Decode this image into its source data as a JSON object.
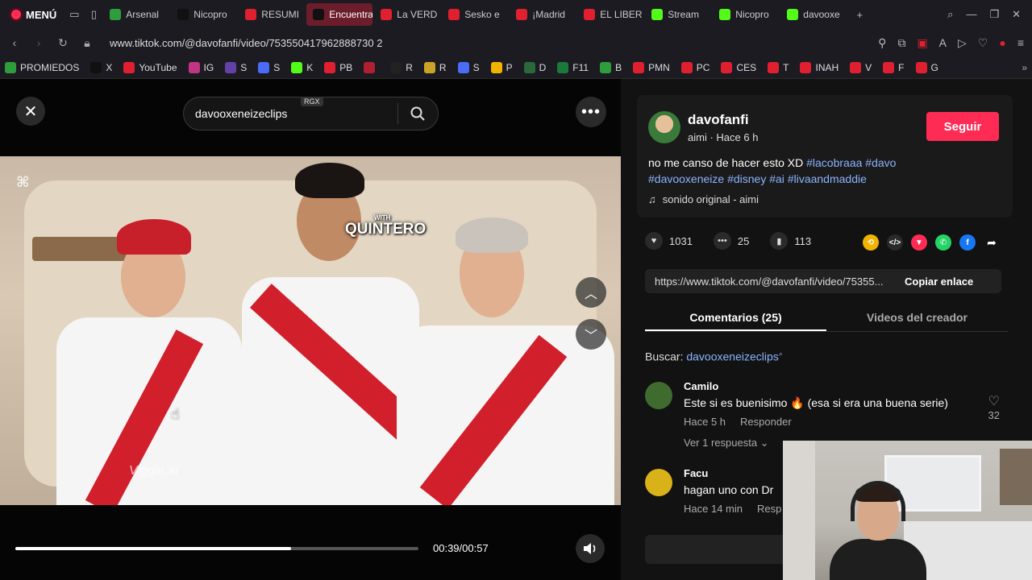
{
  "browser": {
    "menu_label": "MENÚ",
    "tabs": [
      {
        "label": "Arsenal",
        "color": "#2e9d3b"
      },
      {
        "label": "Nicopro",
        "color": "#111111"
      },
      {
        "label": "RESUMI",
        "color": "#e0202f"
      },
      {
        "label": "Encuentra",
        "color": "#111111",
        "active": true
      },
      {
        "label": "La VERD",
        "color": "#e0202f"
      },
      {
        "label": "Sesko e",
        "color": "#e0202f"
      },
      {
        "label": "¡Madrid",
        "color": "#e0202f"
      },
      {
        "label": "EL LIBER",
        "color": "#e0202f"
      },
      {
        "label": "Stream",
        "color": "#53fc18"
      },
      {
        "label": "Nicopro",
        "color": "#53fc18"
      },
      {
        "label": "davooxe",
        "color": "#53fc18"
      }
    ],
    "url": "www.tiktok.com/@davofanfi/video/753550417962888730 2",
    "bookmarks": [
      {
        "label": "PROMIEDOS",
        "color": "#2e9d3b"
      },
      {
        "label": "X",
        "color": "#111111"
      },
      {
        "label": "YouTube",
        "color": "#e0202f"
      },
      {
        "label": "IG",
        "color": "#c13584"
      },
      {
        "label": "S",
        "color": "#6441a5"
      },
      {
        "label": "S",
        "color": "#4a6cf7"
      },
      {
        "label": "K",
        "color": "#53fc18"
      },
      {
        "label": "PB",
        "color": "#e0202f"
      },
      {
        "label": "",
        "color": "#b02030"
      },
      {
        "label": "R",
        "color": "#222222"
      },
      {
        "label": "R",
        "color": "#c9a227"
      },
      {
        "label": "S",
        "color": "#4a6cf7"
      },
      {
        "label": "P",
        "color": "#f2b300"
      },
      {
        "label": "D",
        "color": "#2a6a3a"
      },
      {
        "label": "F11",
        "color": "#1a7a3a"
      },
      {
        "label": "B",
        "color": "#2e9d3b"
      },
      {
        "label": "PMN",
        "color": "#e0202f"
      },
      {
        "label": "PC",
        "color": "#e0202f"
      },
      {
        "label": "CES",
        "color": "#e0202f"
      },
      {
        "label": "T",
        "color": "#e0202f"
      },
      {
        "label": "INAH",
        "color": "#e0202f"
      },
      {
        "label": "V",
        "color": "#e0202f"
      },
      {
        "label": "F",
        "color": "#e0202f"
      },
      {
        "label": "G",
        "color": "#e0202f"
      }
    ]
  },
  "player": {
    "search_value": "davooxeneizeclips",
    "rgx_badge": "RGX",
    "overlay_small": "WITH",
    "overlay_big": "QUINTERO",
    "watermark": "Viggle.ai",
    "time": "00:39/00:57",
    "progress_fraction": 0.684
  },
  "post": {
    "author": "davofanfi",
    "meta": "aimi · Hace 6 h",
    "follow_label": "Seguir",
    "caption_text": "no me canso de hacer esto XD ",
    "hashtags_line1": [
      "#lacobraaa",
      "#davo"
    ],
    "hashtags_line2": [
      "#davooxeneize",
      "#disney",
      "#ai",
      "#livaandmaddie"
    ],
    "music": "sonido original - aimi",
    "likes": "1031",
    "comments": "25",
    "saves": "113",
    "link": "https://www.tiktok.com/@davofanfi/video/75355...",
    "copy_label": "Copiar enlace",
    "tab_comments": "Comentarios (25)",
    "tab_creator": "Videos del creador",
    "search_prefix": "Buscar:",
    "search_term": "davooxeneizeclips"
  },
  "comments": [
    {
      "name": "Camilo",
      "text": "Este si es buenisimo 🔥 (esa si era una buena serie)",
      "time": "Hace 5 h",
      "reply": "Responder",
      "likes": "32",
      "replies": "Ver 1 respuesta",
      "avatar_color": "#3f6b2f"
    },
    {
      "name": "Facu",
      "text": "hagan uno con Dr",
      "time": "Hace 14 min",
      "reply": "Resp",
      "avatar_color": "#d9b21a"
    }
  ]
}
